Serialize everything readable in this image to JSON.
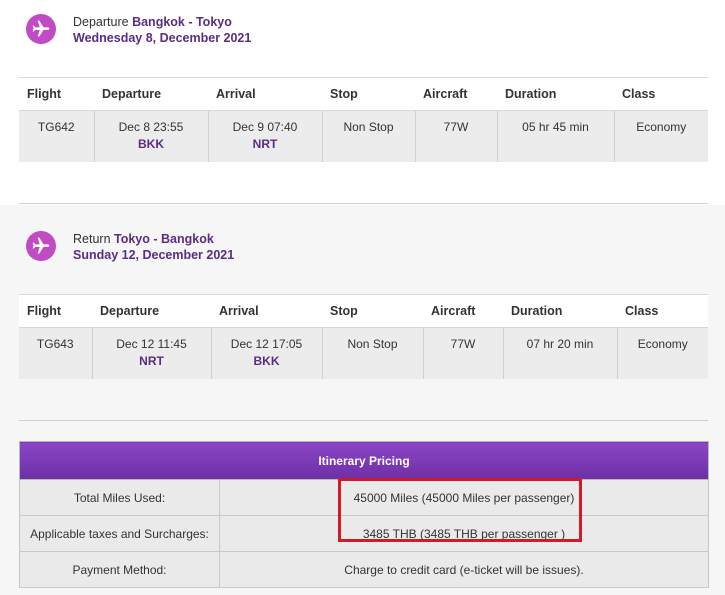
{
  "departure": {
    "label": "Departure",
    "route": "Bangkok - Tokyo",
    "date": "Wednesday 8, December 2021",
    "columns": [
      "Flight",
      "Departure",
      "Arrival",
      "Stop",
      "Aircraft",
      "Duration",
      "Class"
    ],
    "row": {
      "flight": "TG642",
      "dep_time": "Dec 8 23:55",
      "dep_code": "BKK",
      "arr_time": "Dec 9 07:40",
      "arr_code": "NRT",
      "stop": "Non Stop",
      "aircraft": "77W",
      "duration": "05 hr 45 min",
      "class": "Economy"
    }
  },
  "return": {
    "label": "Return",
    "route": "Tokyo - Bangkok",
    "date": "Sunday 12, December 2021",
    "columns": [
      "Flight",
      "Departure",
      "Arrival",
      "Stop",
      "Aircraft",
      "Duration",
      "Class"
    ],
    "row": {
      "flight": "TG643",
      "dep_time": "Dec 12 11:45",
      "dep_code": "NRT",
      "arr_time": "Dec 12 17:05",
      "arr_code": "BKK",
      "stop": "Non Stop",
      "aircraft": "77W",
      "duration": "07 hr 20 min",
      "class": "Economy"
    }
  },
  "pricing": {
    "title": "Itinerary Pricing",
    "rows": [
      {
        "label": "Total Miles Used:",
        "value": "45000 Miles (45000 Miles per passenger)"
      },
      {
        "label": "Applicable taxes and Surcharges:",
        "value": "3485 THB (3485 THB per passenger )"
      },
      {
        "label": "Payment Method:",
        "value": "Charge to credit card (e-ticket will be issues)."
      }
    ]
  },
  "icons": {
    "departure": "plane-takeoff-icon",
    "return": "plane-landing-icon"
  },
  "colors": {
    "accent": "#5a2d82",
    "icon_bg": "#c04bc4",
    "pricing_header": "#7b3ab8",
    "highlight": "#d6192a"
  }
}
